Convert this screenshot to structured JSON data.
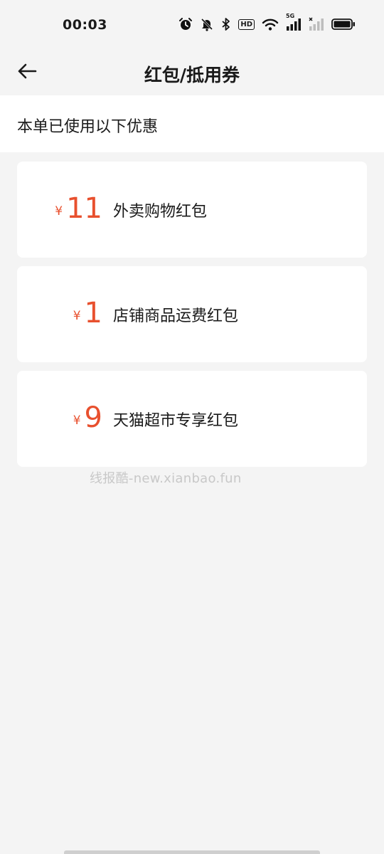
{
  "status_bar": {
    "time": "00:03",
    "hd_label": "HD",
    "network_label": "5G",
    "icons": [
      "alarm-icon",
      "mute-icon",
      "bluetooth-icon",
      "hd-icon",
      "wifi-icon",
      "signal-icon",
      "signal-empty-icon",
      "battery-icon"
    ]
  },
  "header": {
    "title": "红包/抵用券",
    "back_icon": "arrow-left-icon"
  },
  "applied_banner": {
    "text": "本单已使用以下优惠"
  },
  "coupons": [
    {
      "currency": "¥",
      "amount": "11",
      "name": "外卖购物红包"
    },
    {
      "currency": "¥",
      "amount": "1",
      "name": "店铺商品运费红包"
    },
    {
      "currency": "¥",
      "amount": "9",
      "name": "天猫超市专享红包"
    }
  ],
  "watermark": "线报酷-new.xianbao.fun",
  "colors": {
    "accent": "#e8502e",
    "background": "#f4f4f4",
    "card": "#ffffff"
  }
}
